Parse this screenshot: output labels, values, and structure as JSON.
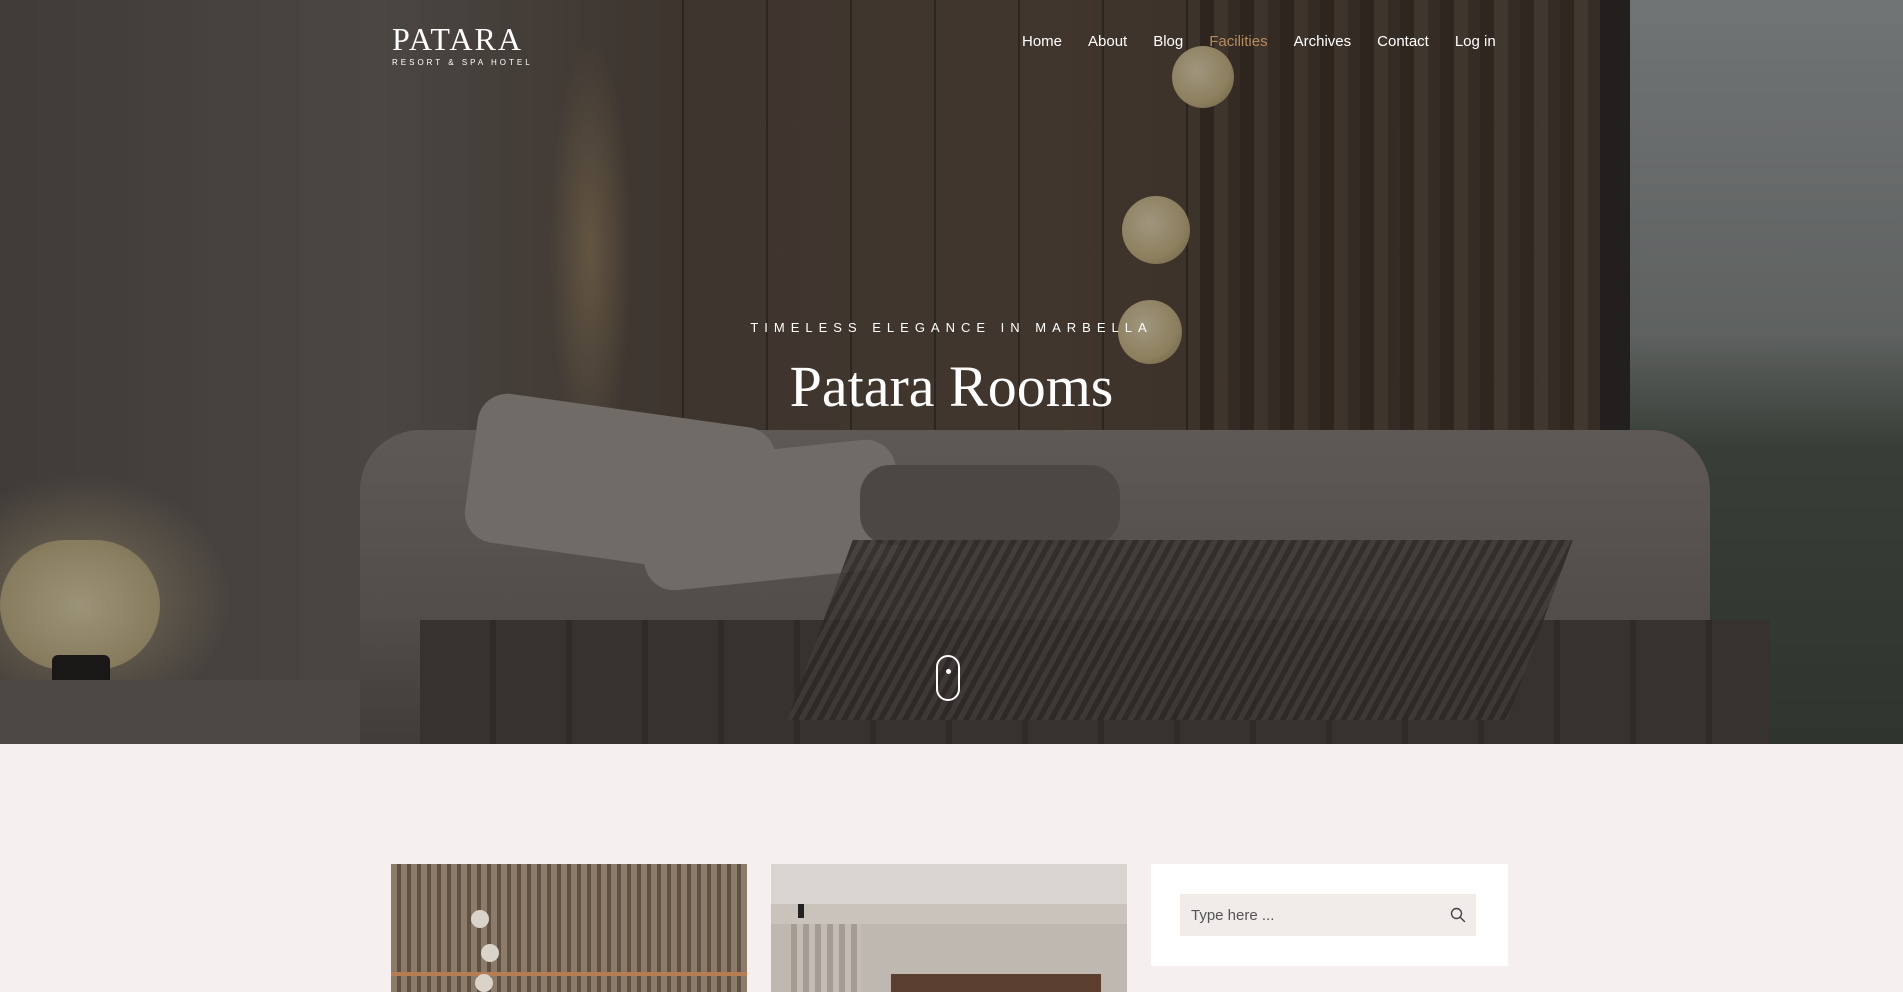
{
  "brand": {
    "name": "PATARA",
    "subtitle": "RESORT & SPA HOTEL"
  },
  "nav": {
    "items": [
      {
        "label": "Home"
      },
      {
        "label": "About"
      },
      {
        "label": "Blog"
      },
      {
        "label": "Facilities",
        "active": true
      },
      {
        "label": "Archives"
      },
      {
        "label": "Contact"
      },
      {
        "label": "Log in"
      }
    ],
    "active_color": "#b78b5e"
  },
  "hero": {
    "tagline": "TIMELESS ELEGANCE IN MARBELLA",
    "title": "Patara Rooms"
  },
  "search": {
    "placeholder": "Type here ...",
    "icon": "search-icon"
  },
  "colors": {
    "page_bg": "#f5f0ef",
    "search_bg": "#f1ebea",
    "accent": "#b78b5e"
  }
}
